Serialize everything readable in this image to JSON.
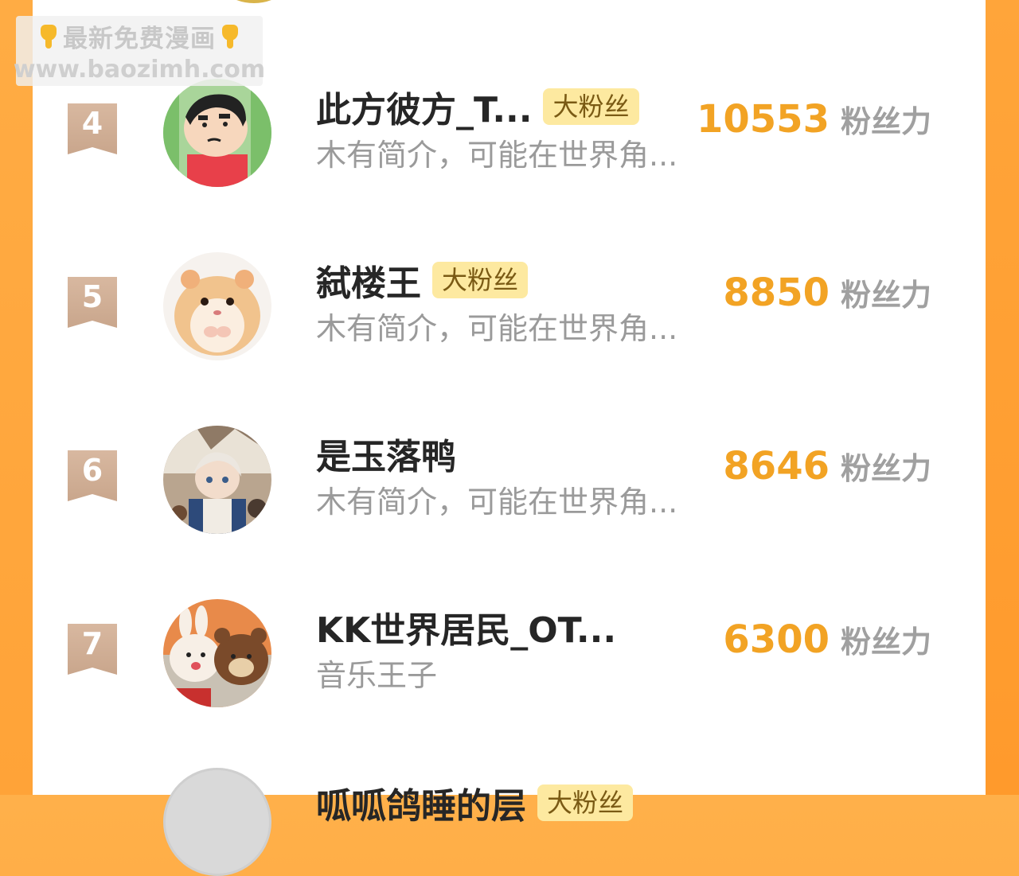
{
  "watermark": {
    "line1": "最新免费漫画",
    "line2": "www.baozimh.com"
  },
  "colors": {
    "accent_orange": "#f2a324",
    "badge_bg": "#fde9a0",
    "rank_ribbon": "#c9a68c",
    "background_orange": "#ffa338"
  },
  "fan_unit": "粉丝力",
  "rows": [
    {
      "rank": "4",
      "name": "此方彼方_T...",
      "badge": "大粉丝",
      "desc": "木有简介，可能在世界角...",
      "score": "10553",
      "avatar": "crayon-shinchan-avatar"
    },
    {
      "rank": "5",
      "name": "弑楼王",
      "badge": "大粉丝",
      "desc": "木有简介，可能在世界角...",
      "score": "8850",
      "avatar": "hamster-avatar"
    },
    {
      "rank": "6",
      "name": "是玉落鸭",
      "badge": "",
      "desc": "木有简介，可能在世界角...",
      "score": "8646",
      "avatar": "anime-character-avatar"
    },
    {
      "rank": "7",
      "name": "KK世界居民_OT...",
      "badge": "",
      "desc": "音乐王子",
      "score": "6300",
      "avatar": "bear-bunny-plush-avatar"
    }
  ],
  "partial_row": {
    "name": "呱呱鸽睡的层",
    "badge": "大粉丝"
  }
}
